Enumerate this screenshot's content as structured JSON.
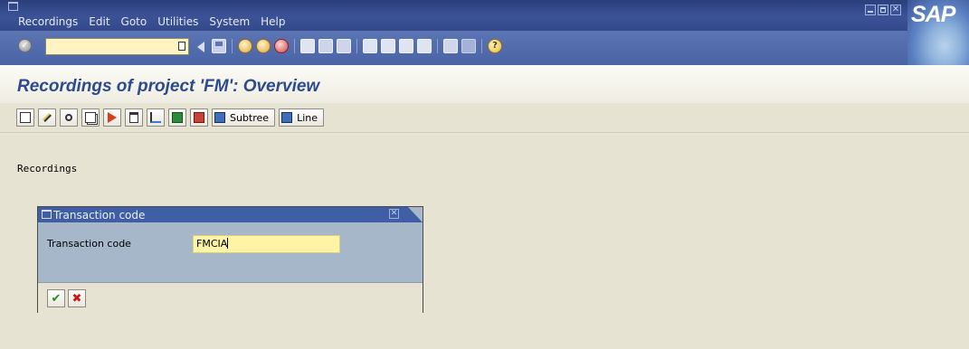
{
  "menubar": {
    "items": [
      "Recordings",
      "Edit",
      "Goto",
      "Utilities",
      "System",
      "Help"
    ],
    "logo": "SAP"
  },
  "toolbar": {
    "command_field_value": ""
  },
  "page": {
    "title": "Recordings of project 'FM': Overview"
  },
  "app_toolbar": {
    "subtree_label": "Subtree",
    "line_label": "Line"
  },
  "main": {
    "section_label": "Recordings"
  },
  "dialog": {
    "title": "Transaction code",
    "field_label": "Transaction code",
    "field_value": "FMCIA"
  },
  "colors": {
    "menubar": "#33498b",
    "toolbar": "#4a63a5",
    "title_text": "#2d4a8c",
    "background": "#e6e3d3",
    "dialog_body": "#a5b7c8",
    "input_bg": "#fdf4a8"
  },
  "icons": {
    "std_toolbar": [
      "enter-icon",
      "back-icon",
      "save-icon",
      "back-nav-icon",
      "exit-icon",
      "cancel-icon",
      "print-icon",
      "find-icon",
      "find-next-icon",
      "first-page-icon",
      "previous-page-icon",
      "next-page-icon",
      "last-page-icon",
      "new-session-icon",
      "shortcut-icon",
      "help-icon"
    ],
    "app_toolbar": [
      "create-icon",
      "change-icon",
      "display-icon",
      "copy-icon",
      "execute-icon",
      "delete-icon",
      "hierarchy-icon",
      "export-icon",
      "import-icon",
      "subtree-icon",
      "line-icon"
    ],
    "dialog": [
      "continue-icon",
      "cancel-icon"
    ]
  }
}
